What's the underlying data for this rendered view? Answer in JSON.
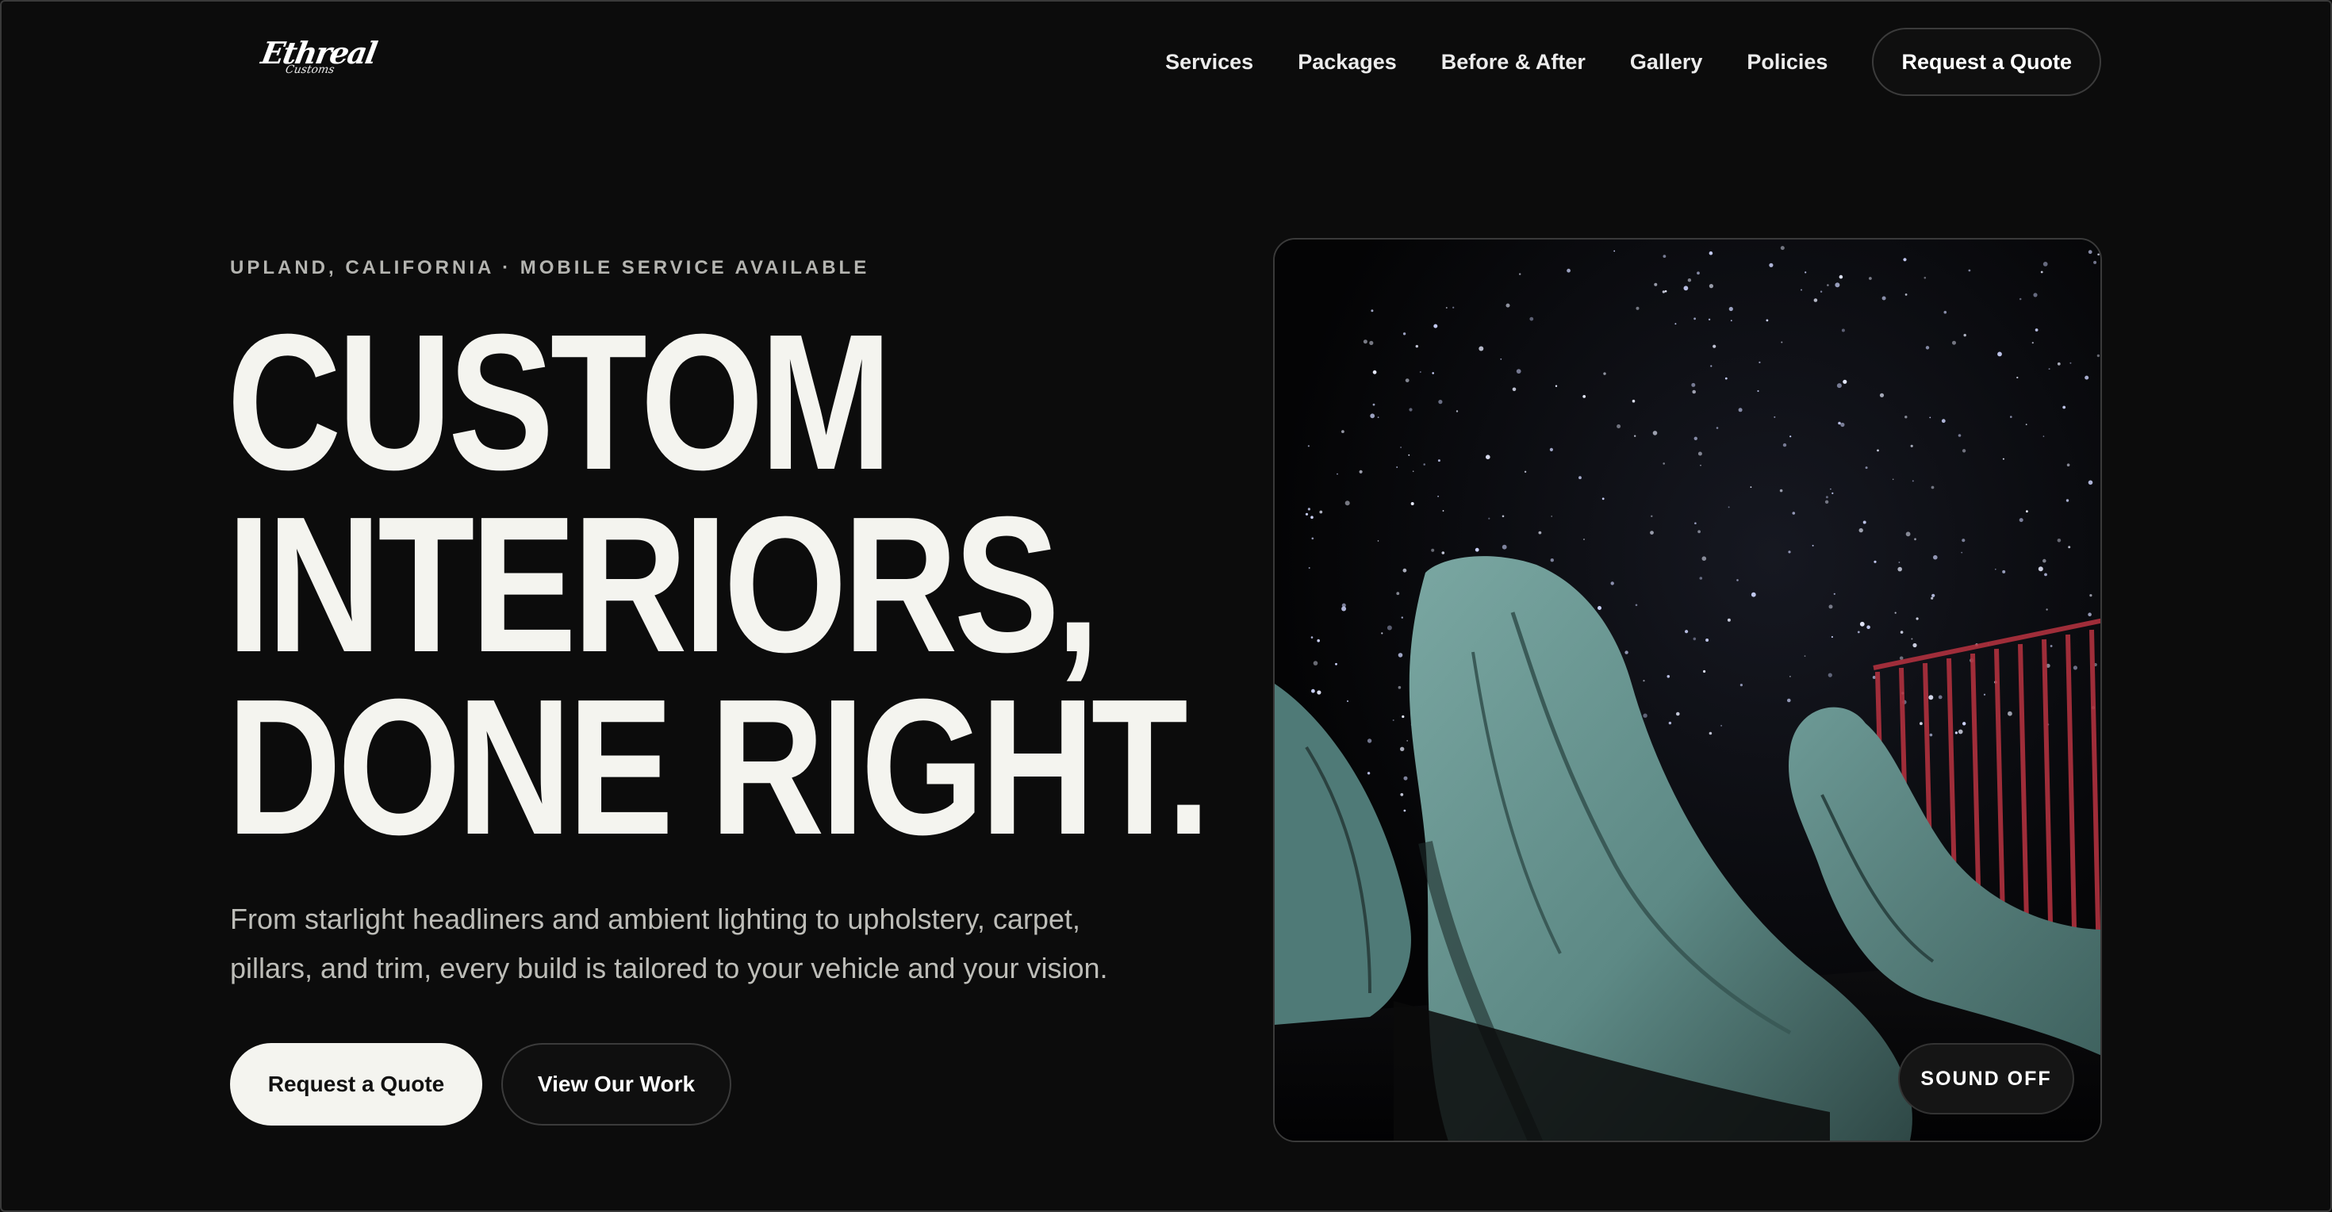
{
  "brand": {
    "logo_text": "Ethreal",
    "logo_subtext": "Customs"
  },
  "nav": {
    "links": [
      "Services",
      "Packages",
      "Before & After",
      "Gallery",
      "Policies"
    ],
    "cta_label": "Request a Quote"
  },
  "hero": {
    "eyebrow": "UPLAND, CALIFORNIA · MOBILE SERVICE AVAILABLE",
    "headline": [
      "CUSTOM",
      "INTERIORS,",
      "DONE RIGHT."
    ],
    "description": "From starlight headliners and ambient lighting to upholstery, carpet, pillars, and trim, every build is tailored to your vehicle and your vision.",
    "primary_button": "Request a Quote",
    "secondary_button": "View Our Work"
  },
  "media": {
    "sound_toggle_label": "SOUND OFF"
  },
  "colors": {
    "background": "#0c0c0c",
    "text": "#f4f4ef",
    "muted_text": "#bdbdb8",
    "seat_teal": "#6f9c98",
    "accent_red": "#b0313e"
  }
}
